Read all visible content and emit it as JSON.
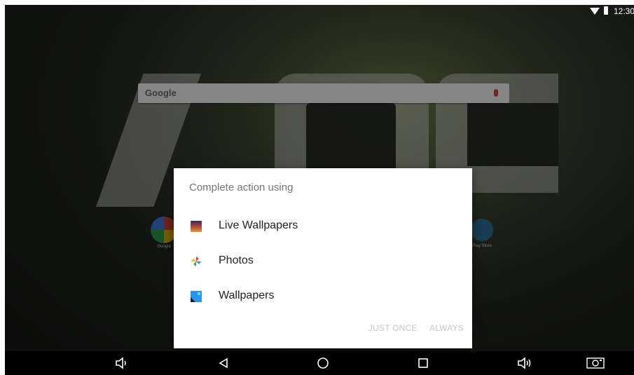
{
  "status_bar": {
    "time": "12:30",
    "icons": [
      "wifi-icon",
      "battery-icon"
    ]
  },
  "home": {
    "search_brand": "Google",
    "search_icons": [
      "mic-icon"
    ],
    "apps": [
      {
        "label": "Google",
        "icon": "google-folder-icon"
      },
      {
        "label": "Play Store",
        "icon": "play-store-icon"
      }
    ]
  },
  "dialog": {
    "title": "Complete action using",
    "options": [
      {
        "label": "Live Wallpapers",
        "icon": "live-wallpapers-icon"
      },
      {
        "label": "Photos",
        "icon": "photos-icon"
      },
      {
        "label": "Wallpapers",
        "icon": "wallpapers-icon"
      }
    ],
    "just_once_label": "JUST ONCE",
    "always_label": "ALWAYS"
  },
  "nav_bar": {
    "buttons": [
      "volume-down-icon",
      "back-icon",
      "home-icon",
      "recents-icon",
      "volume-up-icon",
      "screenshot-icon"
    ]
  },
  "colors": {
    "dialog_bg": "#ffffff",
    "disabled_button": "#c7c7c7",
    "nav_bar_bg": "#000000"
  }
}
